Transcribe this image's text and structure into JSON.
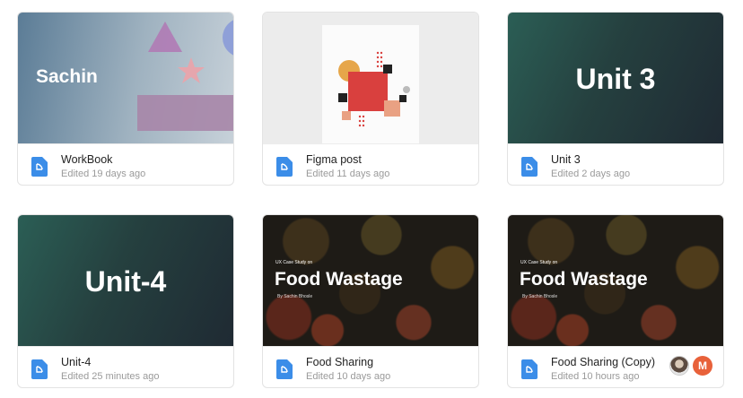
{
  "cards": [
    {
      "name": "WorkBook",
      "edited": "Edited 19 days ago",
      "thumb_text": "Sachin"
    },
    {
      "name": "Figma post",
      "edited": "Edited 11 days ago"
    },
    {
      "name": "Unit 3",
      "edited": "Edited 2 days ago",
      "thumb_text": "Unit 3"
    },
    {
      "name": "Unit-4",
      "edited": "Edited 25 minutes ago",
      "thumb_text": "Unit-4"
    },
    {
      "name": "Food Sharing",
      "edited": "Edited 10 days ago",
      "thumb_small": "UX Case Study on",
      "thumb_text": "Food Wastage",
      "thumb_by": "By Sachin Bhosle"
    },
    {
      "name": "Food Sharing (Copy)",
      "edited": "Edited 10 hours ago",
      "thumb_small": "UX Case Study on",
      "thumb_text": "Food Wastage",
      "thumb_by": "By Sachin Bhosle",
      "collaborator_initial": "M"
    }
  ],
  "icons": {
    "file": "figma-file-icon"
  },
  "colors": {
    "file_icon": "#3b8de8",
    "avatar_m": "#e8613a"
  }
}
